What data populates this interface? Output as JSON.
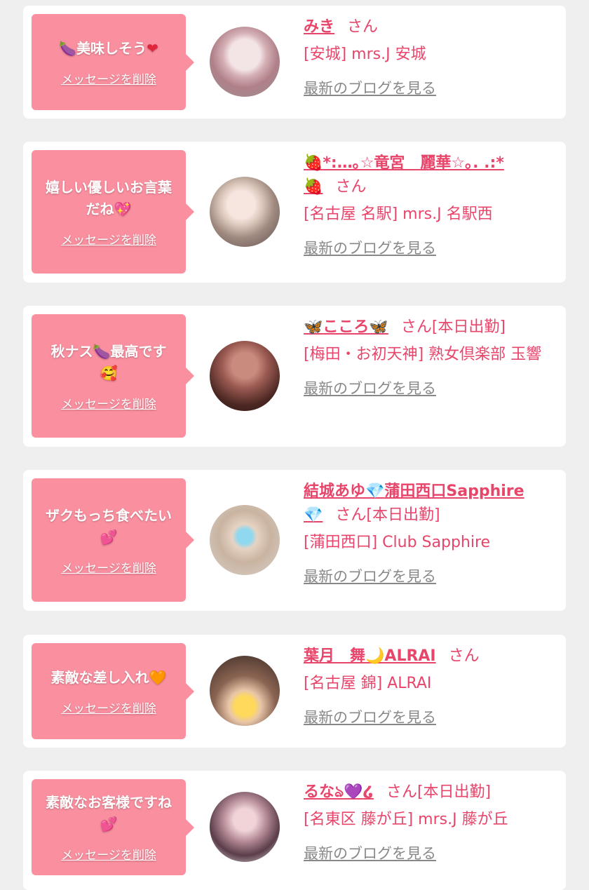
{
  "common": {
    "delete_label": "メッセージを削除",
    "blog_label": "最新のブログを見る",
    "san": "さん"
  },
  "entries": [
    {
      "message_parts": [
        "🍆",
        "美味しそう",
        "❤"
      ],
      "name_parts": [
        "みき"
      ],
      "status": "",
      "shop": "[安城] mrs.J 安城"
    },
    {
      "message_parts": [
        "嬉しい優しいお言葉だね",
        "💖"
      ],
      "name_parts": [
        "🍓",
        "*:…｡☆竜宮　麗華☆｡. .:*",
        "🍓"
      ],
      "status": "",
      "shop": "[名古屋 名駅] mrs.J 名駅西"
    },
    {
      "message_parts": [
        "秋ナス",
        "🍆",
        "最高です",
        "🥰"
      ],
      "name_parts": [
        "🦋",
        "こころ",
        "🦋"
      ],
      "status": "[本日出勤]",
      "shop": "[梅田・お初天神] 熟女倶楽部 玉響"
    },
    {
      "message_parts": [
        "ザクもっち食べたい",
        "💕"
      ],
      "name_parts": [
        "結城あゆ",
        "💎",
        "蒲田西口Sapphire",
        "💎"
      ],
      "status": "[本日出勤]",
      "shop": "[蒲田西口] Club Sapphire"
    },
    {
      "message_parts": [
        "素敵な差し入れ",
        "🧡"
      ],
      "name_parts": [
        "葉月　舞",
        "🌙",
        "ALRAI"
      ],
      "status": "",
      "shop": "[名古屋 錦] ALRAI"
    },
    {
      "message_parts": [
        "素敵なお客様ですね",
        "💕"
      ],
      "name_parts": [
        "るな",
        "ঌ",
        "💜",
        "໒"
      ],
      "status": "[本日出勤]",
      "shop": "[名東区 藤が丘] mrs.J 藤が丘"
    }
  ]
}
